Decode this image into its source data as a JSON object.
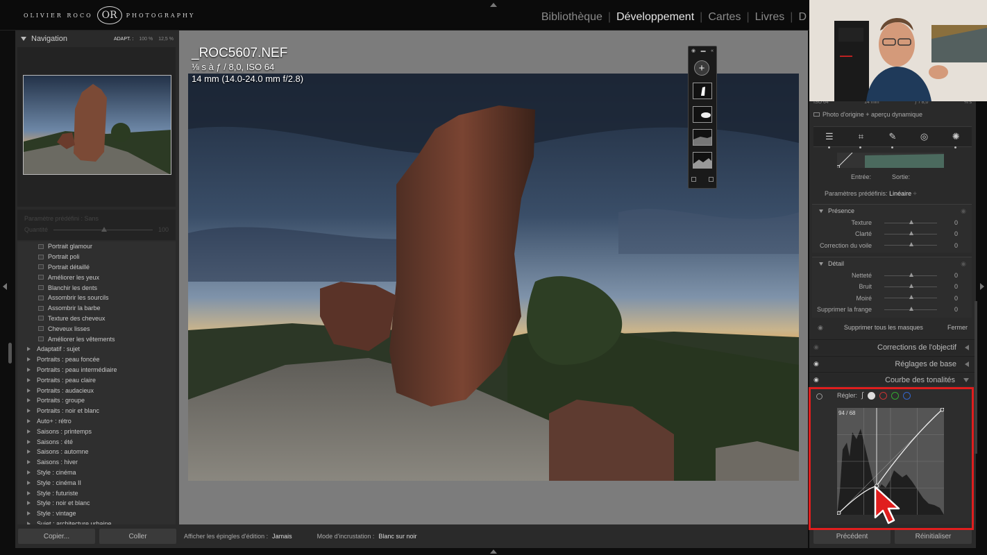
{
  "header": {
    "logo_text": "OLIVIER ROCO",
    "logo_mark": "OR",
    "logo_right": "PHOTOGRAPHY",
    "modules": [
      "Bibliothèque",
      "Développement",
      "Cartes",
      "Livres",
      "D"
    ],
    "active_module": "Développement"
  },
  "navigator": {
    "title": "Navigation",
    "zoom_fit": "ADAPT. :",
    "zoom_100": "100 %",
    "zoom_125": "12,5 %"
  },
  "preset_amount": {
    "label": "Paramètre prédéfini : Sans",
    "amount_label": "Quantité",
    "amount_value": "100"
  },
  "preset_list": {
    "items": [
      {
        "label": "Portrait glamour",
        "type": "sub"
      },
      {
        "label": "Portrait poli",
        "type": "sub"
      },
      {
        "label": "Portrait détaillé",
        "type": "sub"
      },
      {
        "label": "Améliorer les yeux",
        "type": "sub"
      },
      {
        "label": "Blanchir les dents",
        "type": "sub"
      },
      {
        "label": "Assombrir les sourcils",
        "type": "sub"
      },
      {
        "label": "Assombrir la barbe",
        "type": "sub"
      },
      {
        "label": "Texture des cheveux",
        "type": "sub"
      },
      {
        "label": "Cheveux lisses",
        "type": "sub"
      },
      {
        "label": "Améliorer les vêtements",
        "type": "sub"
      },
      {
        "label": "Adaptatif : sujet",
        "type": "grp"
      },
      {
        "label": "Portraits : peau foncée",
        "type": "grp"
      },
      {
        "label": "Portraits : peau intermédiaire",
        "type": "grp"
      },
      {
        "label": "Portraits : peau claire",
        "type": "grp"
      },
      {
        "label": "Portraits : audacieux",
        "type": "grp"
      },
      {
        "label": "Portraits : groupe",
        "type": "grp"
      },
      {
        "label": "Portraits : noir et blanc",
        "type": "grp"
      },
      {
        "label": "Auto+ : rétro",
        "type": "grp"
      },
      {
        "label": "Saisons : printemps",
        "type": "grp"
      },
      {
        "label": "Saisons : été",
        "type": "grp"
      },
      {
        "label": "Saisons : automne",
        "type": "grp"
      },
      {
        "label": "Saisons : hiver",
        "type": "grp"
      },
      {
        "label": "Style : cinéma",
        "type": "grp"
      },
      {
        "label": "Style : cinéma II",
        "type": "grp"
      },
      {
        "label": "Style : futuriste",
        "type": "grp"
      },
      {
        "label": "Style : noir et blanc",
        "type": "grp"
      },
      {
        "label": "Style : vintage",
        "type": "grp"
      },
      {
        "label": "Sujet : architecture urbaine",
        "type": "grp"
      }
    ]
  },
  "left_buttons": {
    "copy": "Copier...",
    "paste": "Coller"
  },
  "photo_info": {
    "filename": "_ROC5607.NEF",
    "line2": "⅛ s à ƒ / 8,0, ISO 64",
    "line3": "14 mm (14.0-24.0 mm f/2.8)"
  },
  "mask_toolbar": {
    "add_symbol": "+"
  },
  "bottom_toolbar": {
    "pins_label": "Afficher les épingles d'édition :",
    "pins_value": "Jamais",
    "overlay_label": "Mode d'incrustation :",
    "overlay_value": "Blanc sur noir"
  },
  "histogram": {
    "iso": "ISO 64",
    "focal": "14 mm",
    "aperture": "ƒ / 8,0",
    "shutter": "⅛ s",
    "original_label": "Photo d'origine + aperçu dynamique"
  },
  "curve_top": {
    "input_label": "Entrée:",
    "output_label": "Sortie:",
    "preset_label": "Paramètres prédéfinis:",
    "preset_value": "Linéaire"
  },
  "presence": {
    "title": "Présence",
    "rows": [
      {
        "label": "Texture",
        "value": "0"
      },
      {
        "label": "Clarté",
        "value": "0"
      },
      {
        "label": "Correction du voile",
        "value": "0"
      }
    ]
  },
  "detail": {
    "title": "Détail",
    "rows": [
      {
        "label": "Netteté",
        "value": "0"
      },
      {
        "label": "Bruit",
        "value": "0"
      },
      {
        "label": "Moiré",
        "value": "0"
      },
      {
        "label": "Supprimer la frange",
        "value": "0"
      }
    ]
  },
  "mask_footer": {
    "delete_all": "Supprimer tous les masques",
    "close": "Fermer"
  },
  "panels": {
    "lens": "Corrections de l'objectif",
    "basic": "Réglages de base",
    "tone_curve": "Courbe des tonalités"
  },
  "tone_curve": {
    "adjust_label": "Régler:",
    "readout": "94 / 68",
    "points": [
      [
        0,
        0
      ],
      [
        0.37,
        0.27
      ],
      [
        1,
        1
      ]
    ]
  },
  "right_buttons": {
    "previous": "Précédent",
    "reset": "Réinitialiser"
  },
  "colors": {
    "highlight": "#e01e1e",
    "panel_bg": "#2a2a2a",
    "canvas_bg": "#7c7c7c"
  }
}
